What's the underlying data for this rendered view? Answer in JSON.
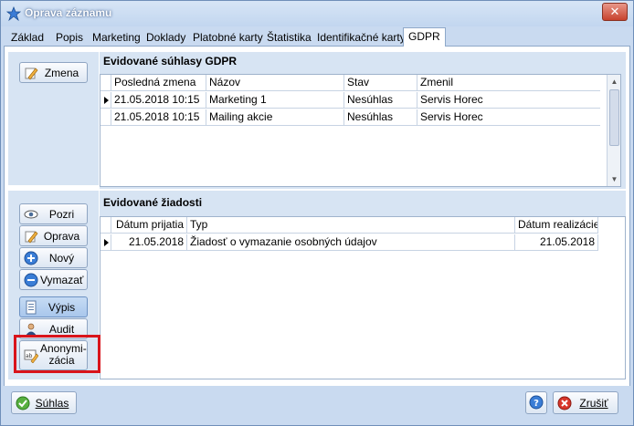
{
  "window": {
    "title": "Oprava záznamu",
    "close_label": "✕"
  },
  "tabs": [
    "Základ",
    "Popis",
    "Marketing",
    "Doklady",
    "Platobné karty",
    "Štatistika",
    "Identifikačné karty",
    "GDPR"
  ],
  "active_tab": "GDPR",
  "consents": {
    "title": "Evidované súhlasy GDPR",
    "button_label": "Zmena",
    "columns": [
      "Posledná zmena",
      "Názov",
      "Stav",
      "Zmenil"
    ],
    "rows": [
      [
        "21.05.2018 10:15",
        "Marketing 1",
        "Nesúhlas",
        "Servis Horec"
      ],
      [
        "21.05.2018 10:15",
        "Mailing akcie",
        "Nesúhlas",
        "Servis Horec"
      ]
    ]
  },
  "requests": {
    "title": "Evidované žiadosti",
    "columns": [
      "Dátum prijatia",
      "Typ",
      "Dátum realizácie"
    ],
    "rows": [
      [
        "21.05.2018",
        "Žiadosť o vymazanie osobných údajov",
        "21.05.2018"
      ]
    ]
  },
  "side_buttons": {
    "view": "Pozri",
    "edit": "Oprava",
    "new": "Nový",
    "delete": "Vymazať",
    "print": "Výpis",
    "audit": "Audit",
    "anonymize": "Anonymi-\nzácia"
  },
  "footer": {
    "agree": "Súhlas",
    "help": "?",
    "cancel": "Zrušiť"
  },
  "colors": {
    "highlight": "#d9141b",
    "window_bg": "#c9daf0",
    "panel_bg": "#d7e4f3"
  }
}
